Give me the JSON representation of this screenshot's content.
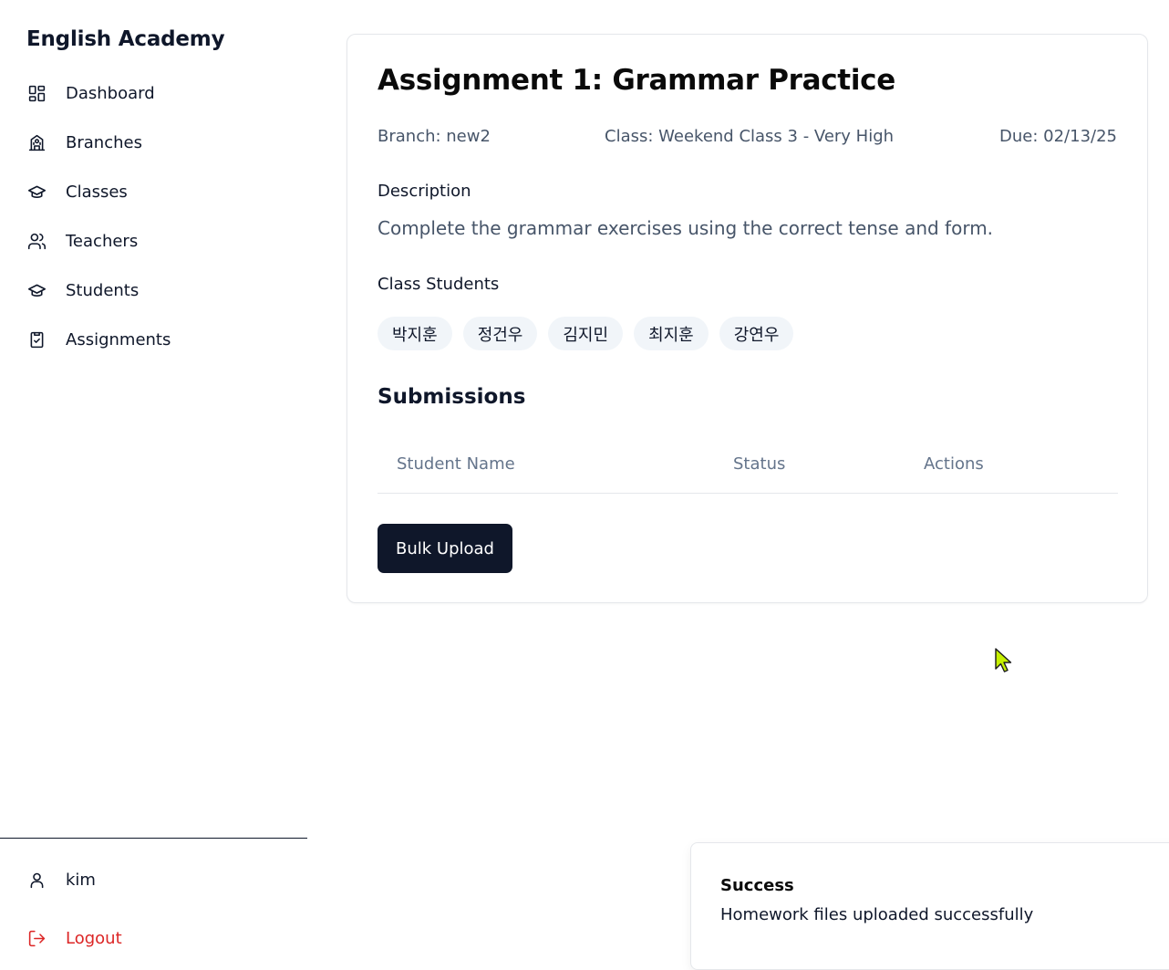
{
  "app": {
    "title": "English Academy"
  },
  "sidebar": {
    "items": [
      {
        "label": "Dashboard",
        "icon": "dashboard-icon"
      },
      {
        "label": "Branches",
        "icon": "building-icon"
      },
      {
        "label": "Classes",
        "icon": "graduation-cap-icon"
      },
      {
        "label": "Teachers",
        "icon": "users-icon"
      },
      {
        "label": "Students",
        "icon": "graduation-cap-icon"
      },
      {
        "label": "Assignments",
        "icon": "clipboard-check-icon"
      }
    ],
    "user": {
      "name": "kim",
      "icon": "user-icon"
    },
    "logout": {
      "label": "Logout",
      "icon": "logout-icon",
      "color": "#dc2626"
    }
  },
  "assignment": {
    "title": "Assignment 1: Grammar Practice",
    "branch": "Branch: new2",
    "class": "Class: Weekend Class 3 - Very High",
    "due": "Due: 02/13/25",
    "description_label": "Description",
    "description": "Complete the grammar exercises using the correct tense and form.",
    "students_label": "Class Students",
    "students": [
      "박지훈",
      "정건우",
      "김지민",
      "최지훈",
      "강연우"
    ]
  },
  "submissions": {
    "title": "Submissions",
    "columns": [
      "Student Name",
      "Status",
      "Actions"
    ],
    "rows": [],
    "bulk_upload_label": "Bulk Upload"
  },
  "toast": {
    "title": "Success",
    "message": "Homework files uploaded successfully"
  },
  "colors": {
    "primary": "#0f172a",
    "muted": "#64748b",
    "chip_bg": "#f1f5f9",
    "danger": "#dc2626"
  }
}
